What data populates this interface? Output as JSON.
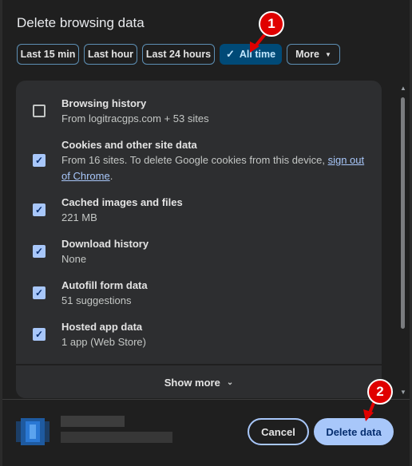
{
  "dialog": {
    "title": "Delete browsing data"
  },
  "time_ranges": [
    {
      "label": "Last 15 min",
      "selected": false
    },
    {
      "label": "Last hour",
      "selected": false
    },
    {
      "label": "Last 24 hours",
      "selected": false
    },
    {
      "label": "All time",
      "selected": true
    },
    {
      "label": "More",
      "selected": false
    }
  ],
  "items": [
    {
      "title": "Browsing history",
      "subtitle": "From logitracgps.com + 53 sites",
      "checked": false
    },
    {
      "title": "Cookies and other site data",
      "subtitle_prefix": "From 16 sites. To delete Google cookies from this device, ",
      "subtitle_link": "sign out of Chrome",
      "subtitle_suffix": ".",
      "checked": true
    },
    {
      "title": "Cached images and files",
      "subtitle": "221 MB",
      "checked": true
    },
    {
      "title": "Download history",
      "subtitle": "None",
      "checked": true
    },
    {
      "title": "Autofill form data",
      "subtitle": "51 suggestions",
      "checked": true
    },
    {
      "title": "Hosted app data",
      "subtitle": "1 app (Web Store)",
      "checked": true
    }
  ],
  "show_more_label": "Show more",
  "buttons": {
    "cancel": "Cancel",
    "delete": "Delete data"
  },
  "annotations": {
    "badge1": "1",
    "badge2": "2"
  },
  "colors": {
    "accent": "#a8c7fa",
    "selected_chip": "#004a77",
    "annotation_red": "#e00000"
  }
}
